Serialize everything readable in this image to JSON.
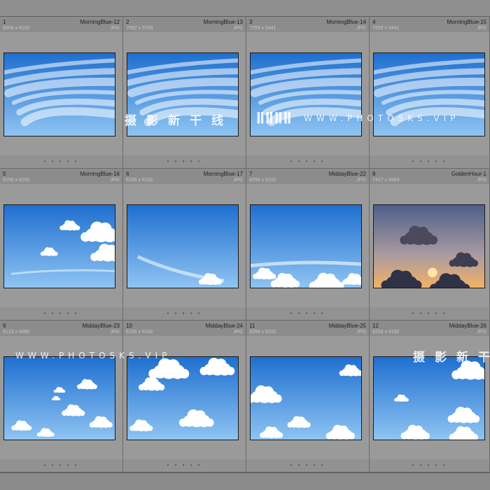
{
  "photos": [
    {
      "index": "1",
      "dims": "8256 x 6192",
      "name": "MorningBlue-12",
      "type": "JPG",
      "dots": "• • • • •",
      "sky": "morning"
    },
    {
      "index": "2",
      "dims": "7692 x 5769",
      "name": "MorningBlue-13",
      "type": "JPG",
      "dots": "• • • • •",
      "sky": "morning"
    },
    {
      "index": "3",
      "dims": "7255 x 5441",
      "name": "MorningBlue-14",
      "type": "JPG",
      "dots": "• • • • •",
      "sky": "morning"
    },
    {
      "index": "4",
      "dims": "7255 x 5441",
      "name": "MorningBlue-15",
      "type": "JPG",
      "dots": "• • • • •",
      "sky": "morning"
    },
    {
      "index": "5",
      "dims": "8256 x 6192",
      "name": "MorningBlue-16",
      "type": "JPG",
      "dots": "• • • • •",
      "sky": "clouds-right"
    },
    {
      "index": "6",
      "dims": "8256 x 6192",
      "name": "MorningBlue-17",
      "type": "JPG",
      "dots": "• • • • •",
      "sky": "clear"
    },
    {
      "index": "7",
      "dims": "8256 x 6192",
      "name": "MiddayBlue-22",
      "type": "JPG",
      "dots": "• • • • •",
      "sky": "clouds-bottom"
    },
    {
      "index": "8",
      "dims": "7417 x 5563",
      "name": "GoldenHour-1",
      "type": "JPG",
      "dots": "• • • • •",
      "sky": "golden"
    },
    {
      "index": "9",
      "dims": "8123 x 6092",
      "name": "MiddayBlue-23",
      "type": "JPG",
      "dots": "• • • • •",
      "sky": "scattered"
    },
    {
      "index": "10",
      "dims": "8256 x 6192",
      "name": "MiddayBlue-24",
      "type": "JPG",
      "dots": "• • • • •",
      "sky": "cumulus"
    },
    {
      "index": "11",
      "dims": "8256 x 6192",
      "name": "MiddayBlue-25",
      "type": "JPG",
      "dots": "• • • • •",
      "sky": "cumulus-left"
    },
    {
      "index": "12",
      "dims": "8256 x 6192",
      "name": "MiddayBlue-26",
      "type": "JPG",
      "dots": "• • • • •",
      "sky": "cumulus-right"
    }
  ],
  "watermarks": {
    "cn_text": "摄影新干线",
    "logo_text": "ǁǁǁǁ",
    "en_text": "WWW.PHOTOSKS.VIP",
    "cn_text_partial": "摄影新干"
  },
  "colors": {
    "sky_top": "#1f6fd0",
    "sky_bottom": "#8ec4f2",
    "golden_top": "#4d5f8a",
    "golden_glow": "#f2b266"
  }
}
